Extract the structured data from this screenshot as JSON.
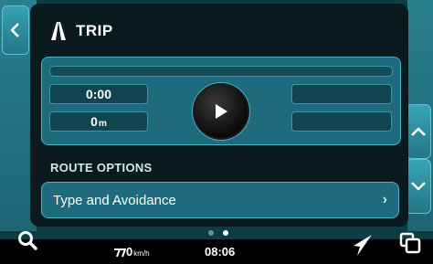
{
  "header": {
    "title": "TRIP",
    "icon": "road-icon"
  },
  "trip": {
    "progress": 0,
    "time_value": "0:00",
    "distance_value": "0",
    "distance_unit": "m",
    "right_fields": [
      "",
      ""
    ]
  },
  "route_options": {
    "section_label": "ROUTE OPTIONS",
    "type_label": "Type and Avoidance",
    "chevron": "›"
  },
  "pagination": {
    "count": 2,
    "active_index": 1
  },
  "status_bar": {
    "speed_value": "0",
    "speed_unit": "km/h",
    "time": "08:06"
  },
  "colors": {
    "accent": "#1d6b7c",
    "border": "#4bb2c3",
    "panel": "#0a1a1f",
    "rail": "#2a7f8f"
  }
}
